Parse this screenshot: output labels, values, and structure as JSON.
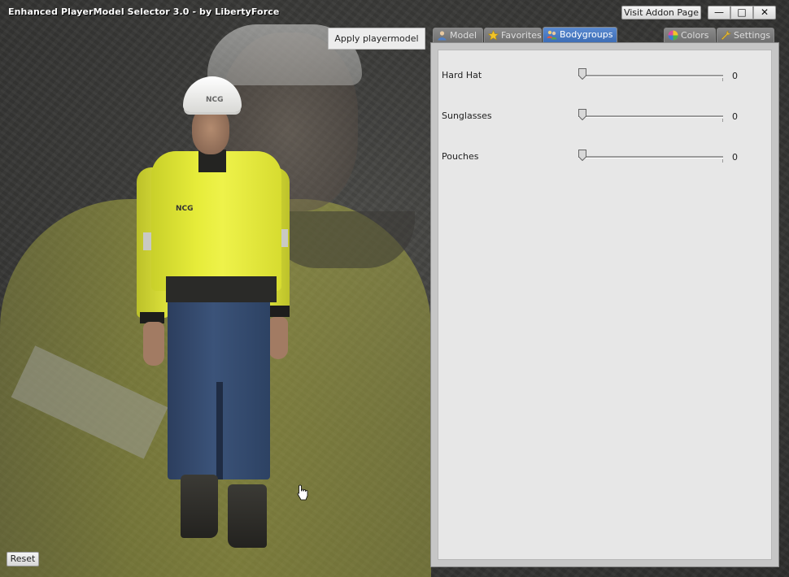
{
  "window": {
    "title": "Enhanced PlayerModel Selector 3.0 - by LibertyForce",
    "visit_label": "Visit Addon Page",
    "minimize_glyph": "—",
    "maximize_glyph": "□",
    "close_glyph": "✕"
  },
  "preview": {
    "apply_label": "Apply playermodel",
    "reset_label": "Reset",
    "helmet_text": "NCG",
    "jacket_text": "NCG"
  },
  "tabs": [
    {
      "label": "Model",
      "icon": "person-icon",
      "active": false
    },
    {
      "label": "Favorites",
      "icon": "star-icon",
      "active": false
    },
    {
      "label": "Bodygroups",
      "icon": "group-icon",
      "active": true
    },
    {
      "label": "Colors",
      "icon": "palette-icon",
      "active": false
    },
    {
      "label": "Settings",
      "icon": "wrench-icon",
      "active": false
    }
  ],
  "bodygroups": [
    {
      "label": "Hard Hat",
      "value": "0"
    },
    {
      "label": "Sunglasses",
      "value": "0"
    },
    {
      "label": "Pouches",
      "value": "0"
    }
  ],
  "colors": {
    "active_tab": "#4a7cc4",
    "tab_inactive": "#7c7c7c",
    "panel_bg": "#e7e7e7"
  }
}
